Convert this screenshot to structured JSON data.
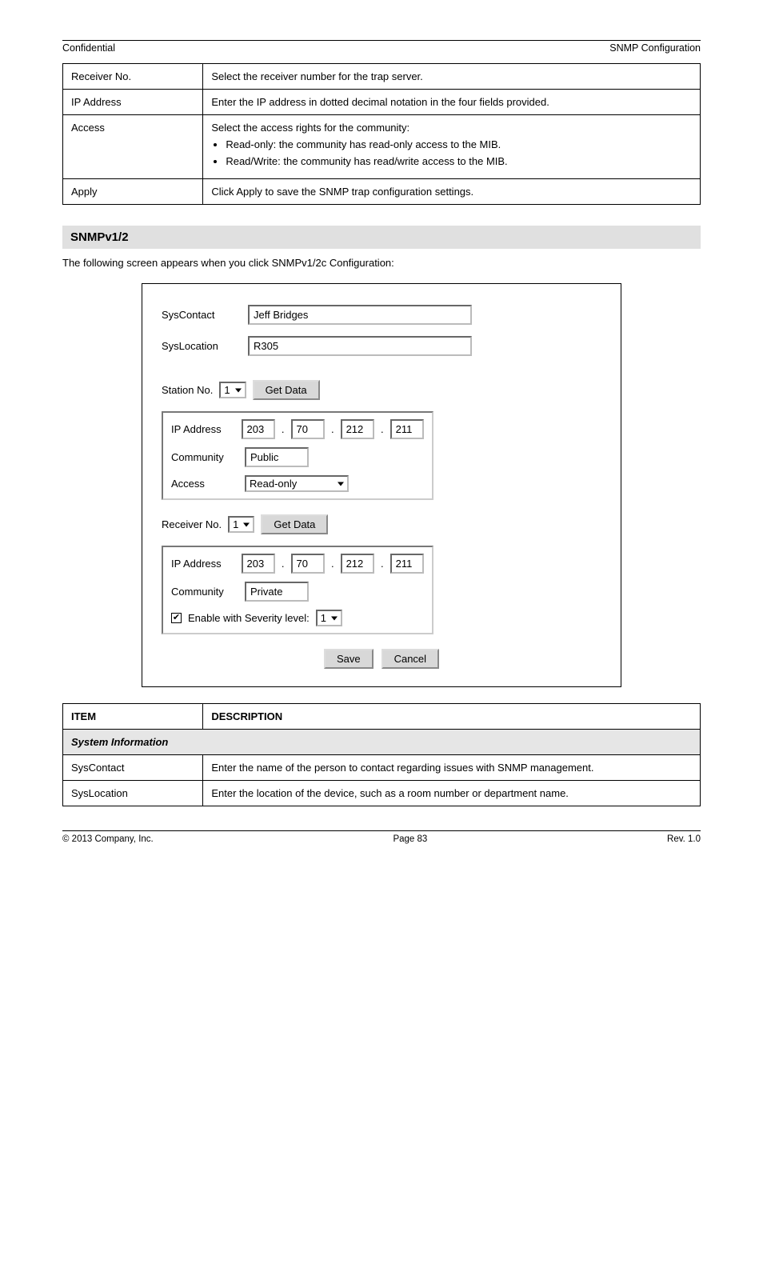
{
  "header": {
    "left": "Confidential",
    "right": "SNMP Configuration"
  },
  "table1": {
    "rows": [
      {
        "col1": "Receiver No.",
        "col2": "Select the receiver number for the trap server."
      },
      {
        "col1": "IP Address",
        "col2": "Enter the IP address in dotted decimal notation in the four fields provided."
      },
      {
        "col1": "Access",
        "col2_intro": "Select the access rights for the community:",
        "bullets": [
          "Read-only: the community has read-only access to the MIB.",
          "Read/Write: the community has read/write access to the MIB."
        ]
      },
      {
        "col1": "Apply",
        "col2": "Click Apply to save the SNMP trap configuration settings."
      }
    ]
  },
  "section": {
    "title": "SNMPv1/2",
    "subtitle": "The following screen appears when you click SNMPv1/2c Configuration:"
  },
  "screenshot": {
    "syscontact_label": "SysContact",
    "syscontact_value": "Jeff Bridges",
    "syslocation_label": "SysLocation",
    "syslocation_value": "R305",
    "station_label": "Station No.",
    "station_value": "1",
    "getdata_label": "Get Data",
    "ipaddress_label": "IP Address",
    "station_ip": [
      "203",
      "70",
      "212",
      "211"
    ],
    "community_label": "Community",
    "station_community": "Public",
    "access_label": "Access",
    "access_value": "Read-only",
    "receiver_label": "Receiver No.",
    "receiver_value": "1",
    "receiver_ip": [
      "203",
      "70",
      "212",
      "211"
    ],
    "receiver_community": "Private",
    "enable_label": "Enable with Severity level:",
    "enable_value": "1",
    "save_label": "Save",
    "cancel_label": "Cancel"
  },
  "table2": {
    "header": {
      "col1": "ITEM",
      "col2": "DESCRIPTION"
    },
    "section_label": "System Information",
    "rows": [
      {
        "col1": "SysContact",
        "col2": "Enter the name of the person to contact regarding issues with SNMP management."
      },
      {
        "col1": "SysLocation",
        "col2": "Enter the location of the device, such as a room number or department name."
      }
    ]
  },
  "footer": {
    "left": "© 2013 Company, Inc.",
    "center": "Page 83",
    "right": "Rev. 1.0"
  }
}
